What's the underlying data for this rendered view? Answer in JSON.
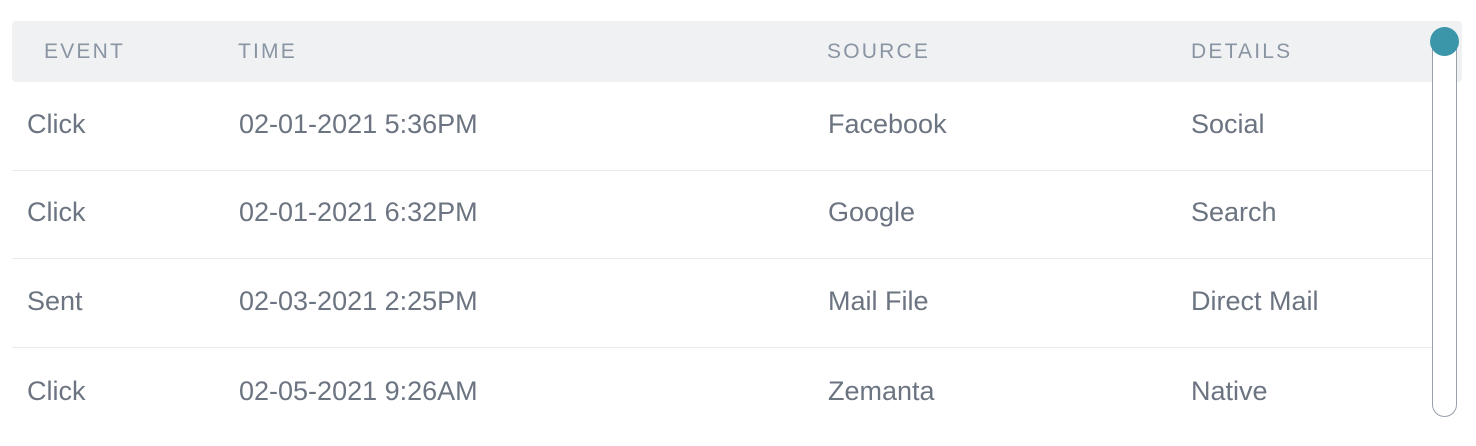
{
  "table": {
    "columns": [
      "EVENT",
      "TIME",
      "SOURCE",
      "DETAILS"
    ],
    "rows": [
      {
        "event": "Click",
        "time": "02-01-2021 5:36PM",
        "source": "Facebook",
        "details": "Social"
      },
      {
        "event": "Click",
        "time": "02-01-2021 6:32PM",
        "source": "Google",
        "details": "Search"
      },
      {
        "event": "Sent",
        "time": "02-03-2021 2:25PM",
        "source": "Mail File",
        "details": "Direct Mail"
      },
      {
        "event": "Click",
        "time": "02-05-2021 9:26AM",
        "source": "Zemanta",
        "details": "Native"
      }
    ]
  },
  "colors": {
    "header_bg": "#f0f1f3",
    "header_text": "#8a95a3",
    "cell_text": "#6b7480",
    "row_divider": "#e7e9ec",
    "scroll_thumb": "#3a96a8",
    "scroll_track_border": "#9aa1ab"
  }
}
